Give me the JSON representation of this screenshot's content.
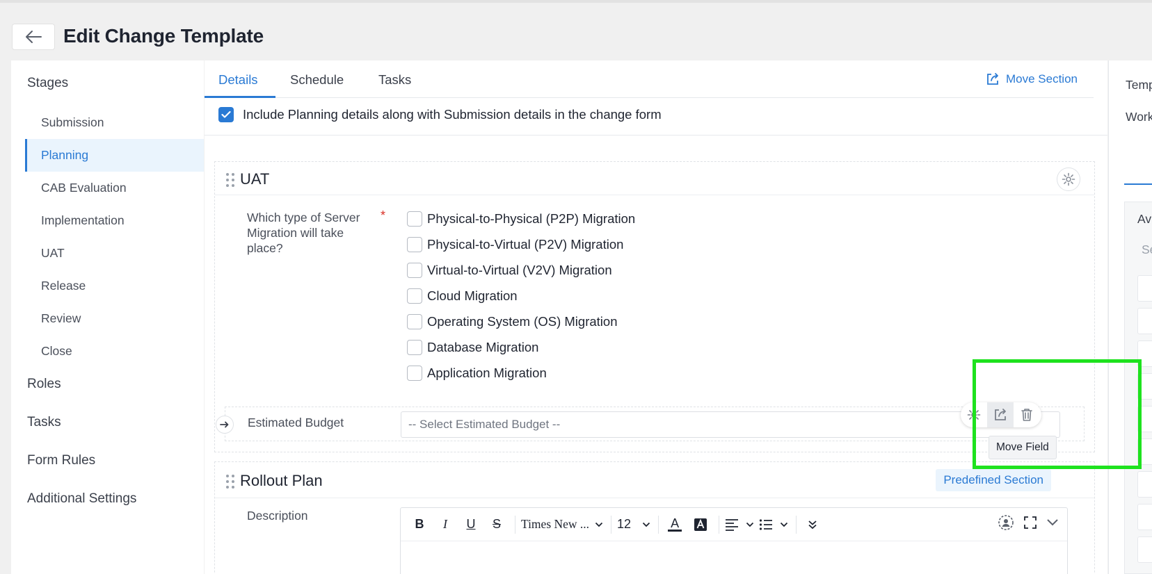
{
  "header": {
    "back_label": "Back",
    "title": "Edit Change Template"
  },
  "sidebar": {
    "stages_heading": "Stages",
    "stages": [
      {
        "label": "Submission",
        "active": false
      },
      {
        "label": "Planning",
        "active": true
      },
      {
        "label": "CAB Evaluation",
        "active": false
      },
      {
        "label": "Implementation",
        "active": false
      },
      {
        "label": "UAT",
        "active": false
      },
      {
        "label": "Release",
        "active": false
      },
      {
        "label": "Review",
        "active": false
      },
      {
        "label": "Close",
        "active": false
      }
    ],
    "sections": [
      "Roles",
      "Tasks",
      "Form Rules",
      "Additional Settings"
    ]
  },
  "tabs": {
    "items": [
      "Details",
      "Schedule",
      "Tasks"
    ],
    "active": "Details",
    "move_section_label": "Move Section"
  },
  "include_planning": {
    "checked": true,
    "label": "Include Planning details along with Submission details in the change form"
  },
  "uat_section": {
    "title": "UAT",
    "question": {
      "label": "Which type of Server Migration will take place?",
      "required_mark": "*",
      "options": [
        "Physical-to-Physical (P2P) Migration",
        "Physical-to-Virtual (P2V) Migration",
        "Virtual-to-Virtual (V2V) Migration",
        "Cloud Migration",
        "Operating System (OS) Migration",
        "Database Migration",
        "Application Migration"
      ]
    },
    "budget": {
      "label": "Estimated Budget",
      "placeholder": "-- Select Estimated Budget --"
    },
    "field_actions": {
      "tooltip": "Move Field"
    }
  },
  "rollout_section": {
    "title": "Rollout Plan",
    "badge": "Predefined Section",
    "description_label": "Description",
    "editor": {
      "bold": "B",
      "italic": "I",
      "underline": "U",
      "strike": "S",
      "font_family": "Times New ...",
      "font_size": "12",
      "font_color": "A"
    }
  },
  "right_panel": {
    "line1": "Temp",
    "line2": "Work",
    "box_line1": "Av",
    "box_line2": "Se"
  },
  "colors": {
    "accent": "#2a7ad4",
    "highlight": "#1ee21e",
    "required": "#d93025"
  }
}
